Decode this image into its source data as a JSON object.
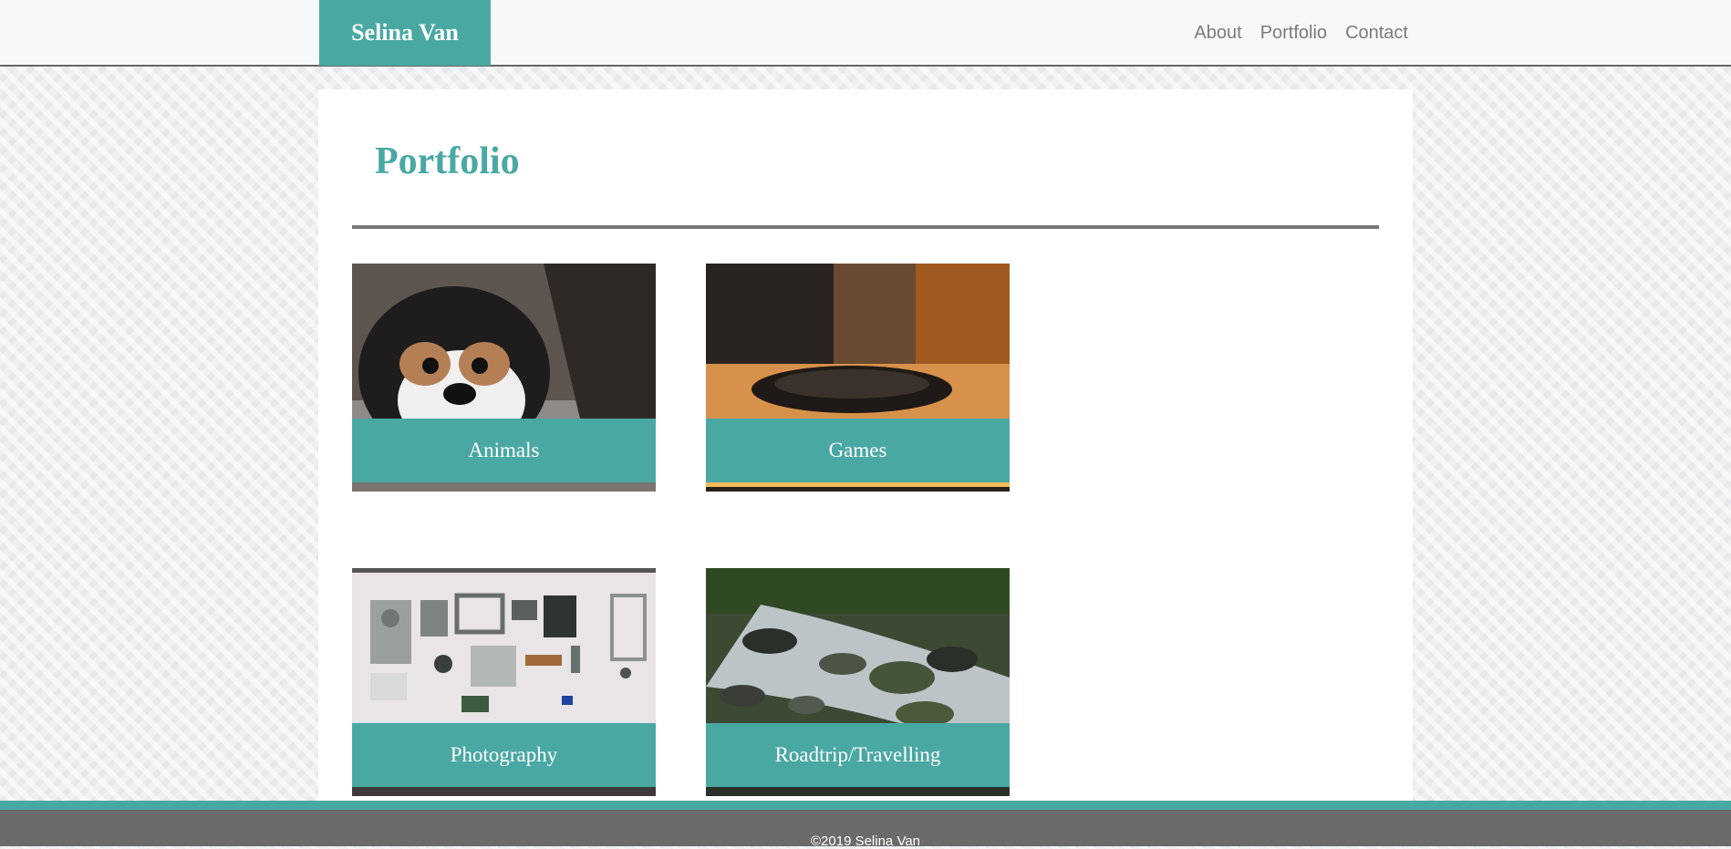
{
  "header": {
    "brand": "Selina Van",
    "nav": [
      "About",
      "Portfolio",
      "Contact"
    ]
  },
  "main": {
    "title": "Portfolio",
    "cards": [
      {
        "label": "Animals",
        "image": "puppy-photo"
      },
      {
        "label": "Games",
        "image": "headphones-photo"
      },
      {
        "label": "Photography",
        "image": "camera-parts-photo"
      },
      {
        "label": "Roadtrip/Travelling",
        "image": "stream-rocks-photo"
      }
    ]
  },
  "footer": {
    "text": "©2019 Selina Van"
  },
  "colors": {
    "accent": "#4aa8a3",
    "footer": "#6b6b6b",
    "nav_text": "#7a7a7a"
  }
}
